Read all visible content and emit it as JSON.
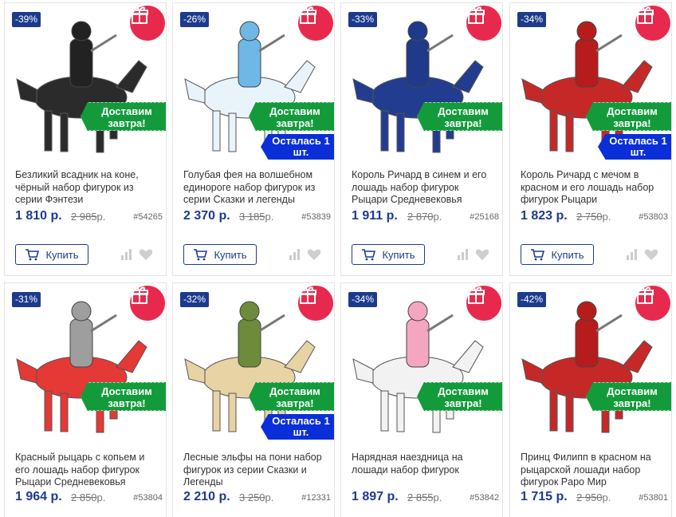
{
  "products": [
    {
      "discount": "-39%",
      "title": "Безликий всадник на коне, чёрный набор фигурок из серии Фэнтези",
      "price": "1 810 р.",
      "old_price": "2 985",
      "old_price_suffix": "р.",
      "sku": "#54265",
      "delivery": "Доставим завтра!",
      "stock": "",
      "buy_label": "Купить",
      "figure_color": "#222222",
      "horse_color": "#2b2b2b"
    },
    {
      "discount": "-26%",
      "title": "Голубая фея на волшебном единороге набор фигурок из серии Сказки и легенды",
      "price": "2 370 р.",
      "old_price": "3 185",
      "old_price_suffix": "р.",
      "sku": "#53839",
      "delivery": "Доставим завтра!",
      "stock": "Осталась 1 шт.",
      "buy_label": "Купить",
      "figure_color": "#6fb8e6",
      "horse_color": "#e9f3fa"
    },
    {
      "discount": "-33%",
      "title": "Король Ричард в синем и его лошадь набор фигурок Рыцари Средневековья",
      "price": "1 911 р.",
      "old_price": "2 870",
      "old_price_suffix": "р.",
      "sku": "#25168",
      "delivery": "Доставим завтра!",
      "stock": "",
      "buy_label": "Купить",
      "figure_color": "#1f3a8a",
      "horse_color": "#223d8f"
    },
    {
      "discount": "-34%",
      "title": "Король Ричард с мечом в красном и его лошадь набор фигурок Рыцари",
      "price": "1 823 р.",
      "old_price": "2 750",
      "old_price_suffix": "р.",
      "sku": "#53803",
      "delivery": "Доставим завтра!",
      "stock": "Осталась 1 шт.",
      "buy_label": "Купить",
      "figure_color": "#b71c1c",
      "horse_color": "#c62828"
    },
    {
      "discount": "-31%",
      "title": "Красный рыцарь с копьем и его лошадь набор фигурок Рыцари Средневековья",
      "price": "1 964 р.",
      "old_price": "2 850",
      "old_price_suffix": "р.",
      "sku": "#53804",
      "delivery": "Доставим завтра!",
      "stock": "",
      "buy_label": "Купить",
      "figure_color": "#9e9e9e",
      "horse_color": "#e53935"
    },
    {
      "discount": "-32%",
      "title": "Лесные эльфы на пони набор фигурок из серии Сказки и Легенды",
      "price": "2 210 р.",
      "old_price": "3 250",
      "old_price_suffix": "р.",
      "sku": "#12331",
      "delivery": "Доставим завтра!",
      "stock": "Осталась 1 шт.",
      "buy_label": "Купить",
      "figure_color": "#6d8b3a",
      "horse_color": "#e8d3a5"
    },
    {
      "discount": "-34%",
      "title": "Нарядная наездница на лошади набор фигурок",
      "price": "1 897 р.",
      "old_price": "2 855",
      "old_price_suffix": "р.",
      "sku": "#53842",
      "delivery": "Доставим завтра!",
      "stock": "",
      "buy_label": "Купить",
      "figure_color": "#f4a6c0",
      "horse_color": "#f2f2f2"
    },
    {
      "discount": "-42%",
      "title": "Принц Филипп в красном на рыцарской лошади набор фигурок Papo Мир",
      "price": "1 715 р.",
      "old_price": "2 950",
      "old_price_suffix": "р.",
      "sku": "#53801",
      "delivery": "Доставим завтра!",
      "stock": "",
      "buy_label": "Купить",
      "figure_color": "#b71c1c",
      "horse_color": "#c62828"
    }
  ],
  "colors": {
    "accent_blue": "#1d3b8c",
    "gift_red": "#e8294e",
    "delivery_green": "#139b3b",
    "stock_blue": "#0a2fd8"
  }
}
